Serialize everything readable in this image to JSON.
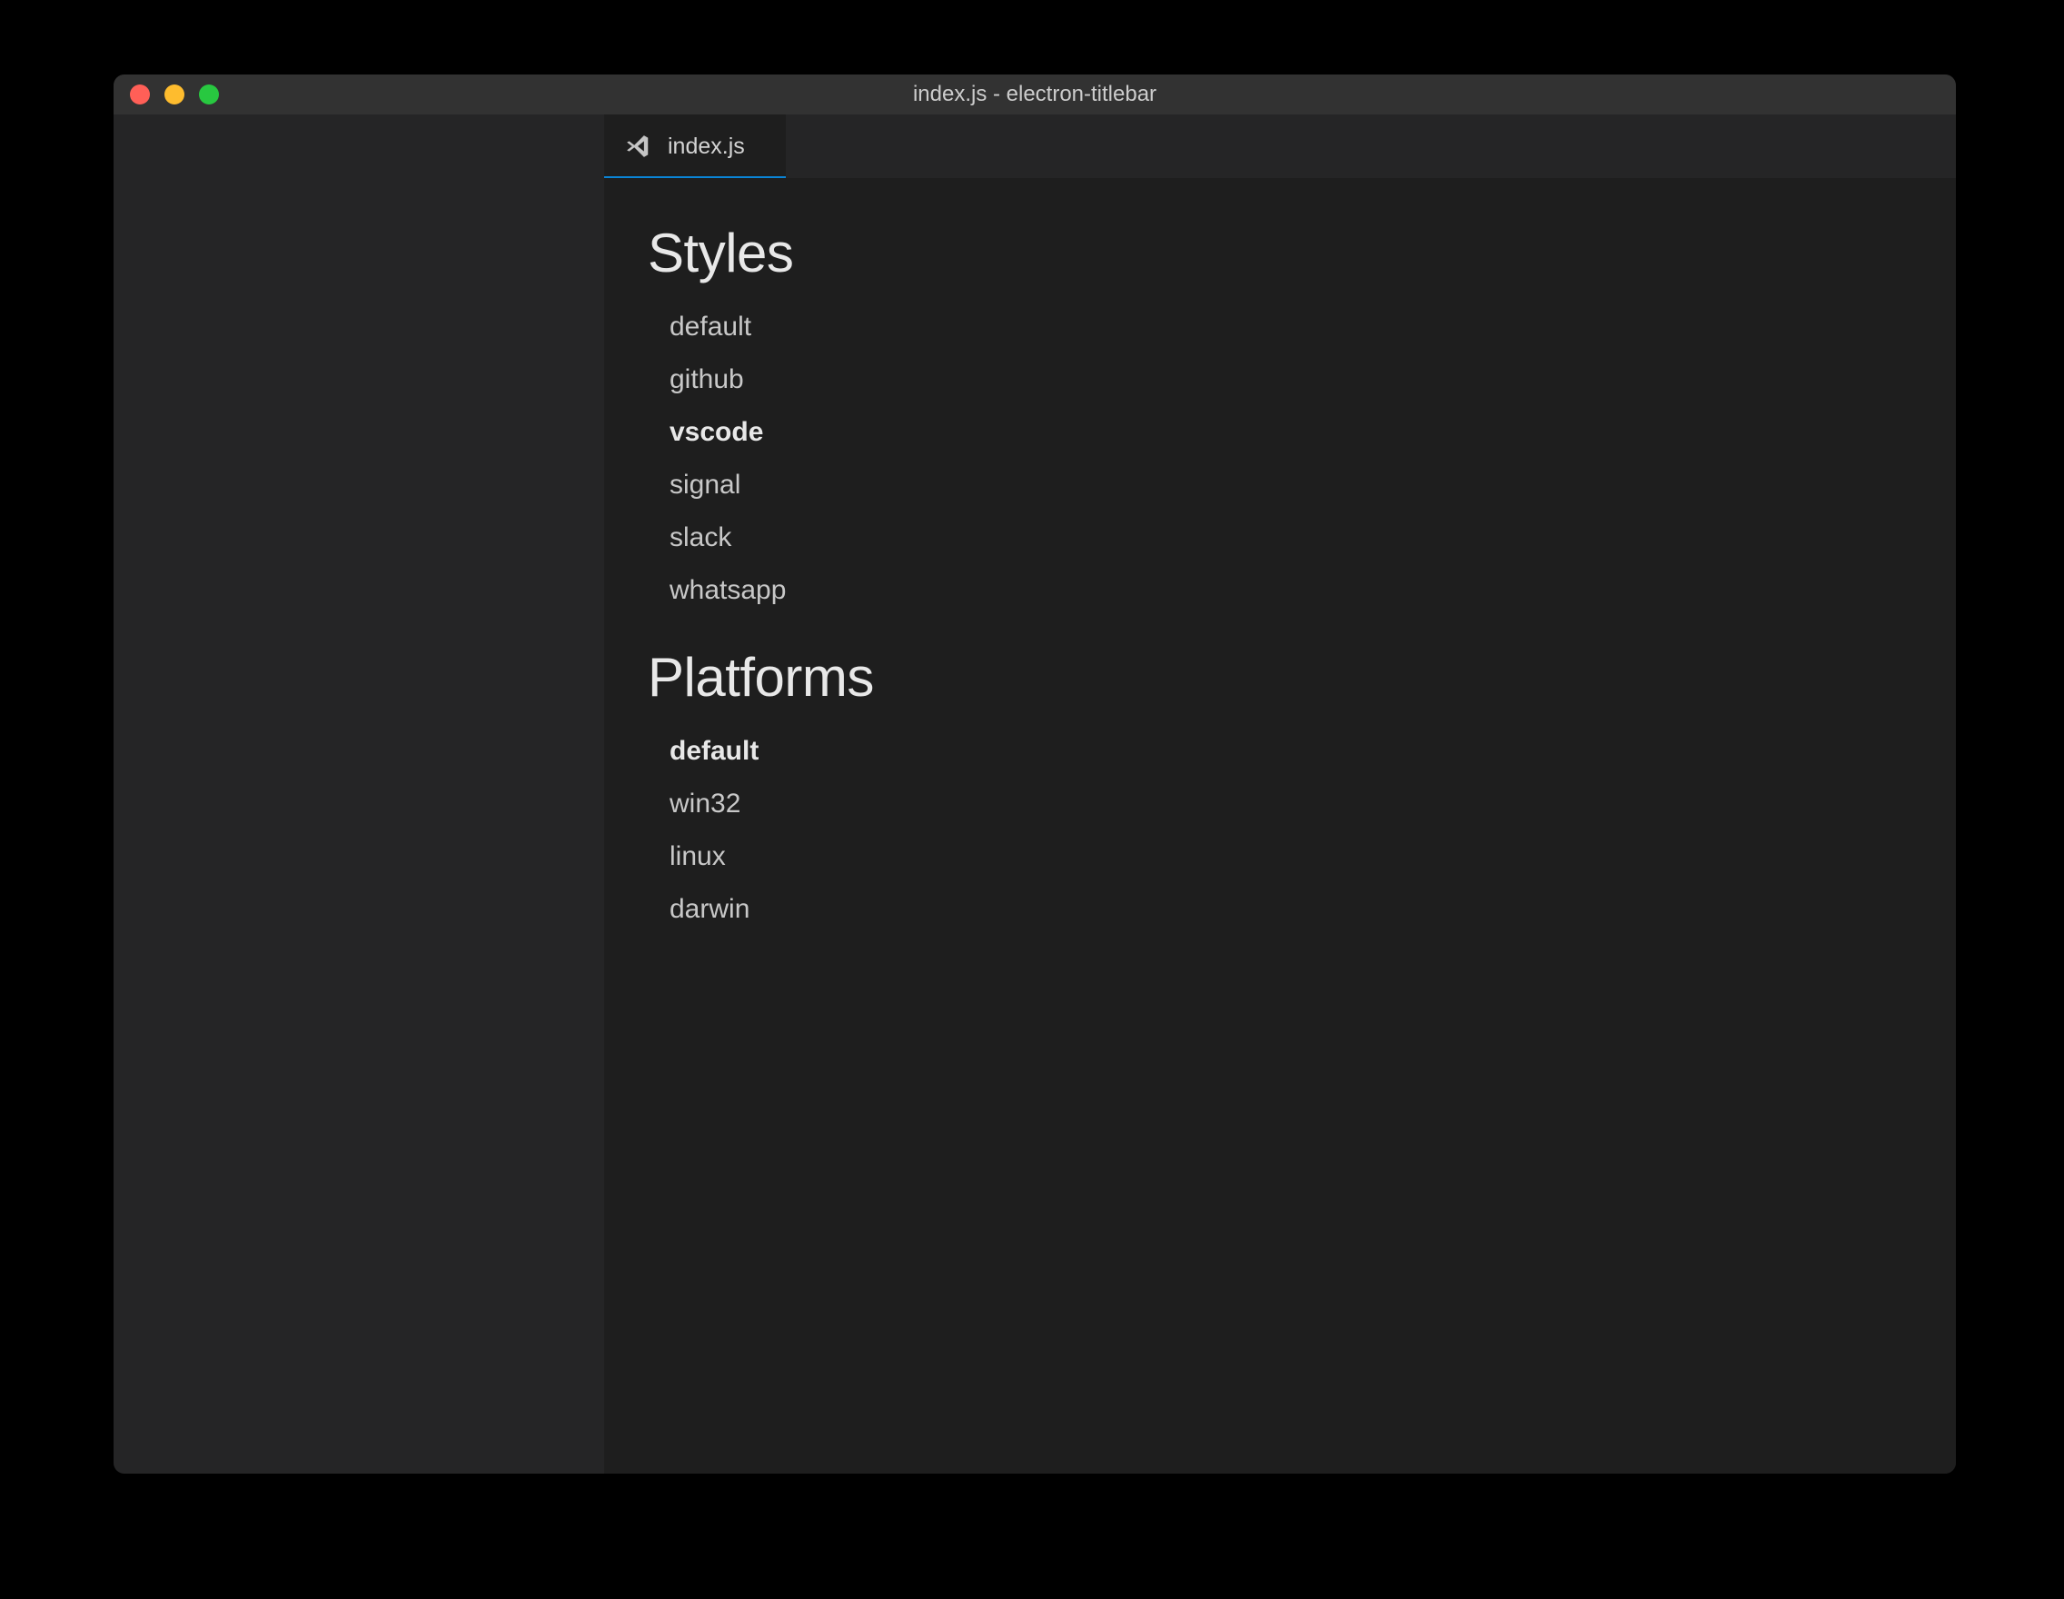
{
  "window": {
    "title": "index.js - electron-titlebar"
  },
  "tabs": [
    {
      "label": "index.js",
      "icon": "vscode-icon",
      "active": true
    }
  ],
  "sections": {
    "styles": {
      "heading": "Styles",
      "items": [
        {
          "label": "default",
          "selected": false
        },
        {
          "label": "github",
          "selected": false
        },
        {
          "label": "vscode",
          "selected": true
        },
        {
          "label": "signal",
          "selected": false
        },
        {
          "label": "slack",
          "selected": false
        },
        {
          "label": "whatsapp",
          "selected": false
        }
      ]
    },
    "platforms": {
      "heading": "Platforms",
      "items": [
        {
          "label": "default",
          "selected": true
        },
        {
          "label": "win32",
          "selected": false
        },
        {
          "label": "linux",
          "selected": false
        },
        {
          "label": "darwin",
          "selected": false
        }
      ]
    }
  }
}
